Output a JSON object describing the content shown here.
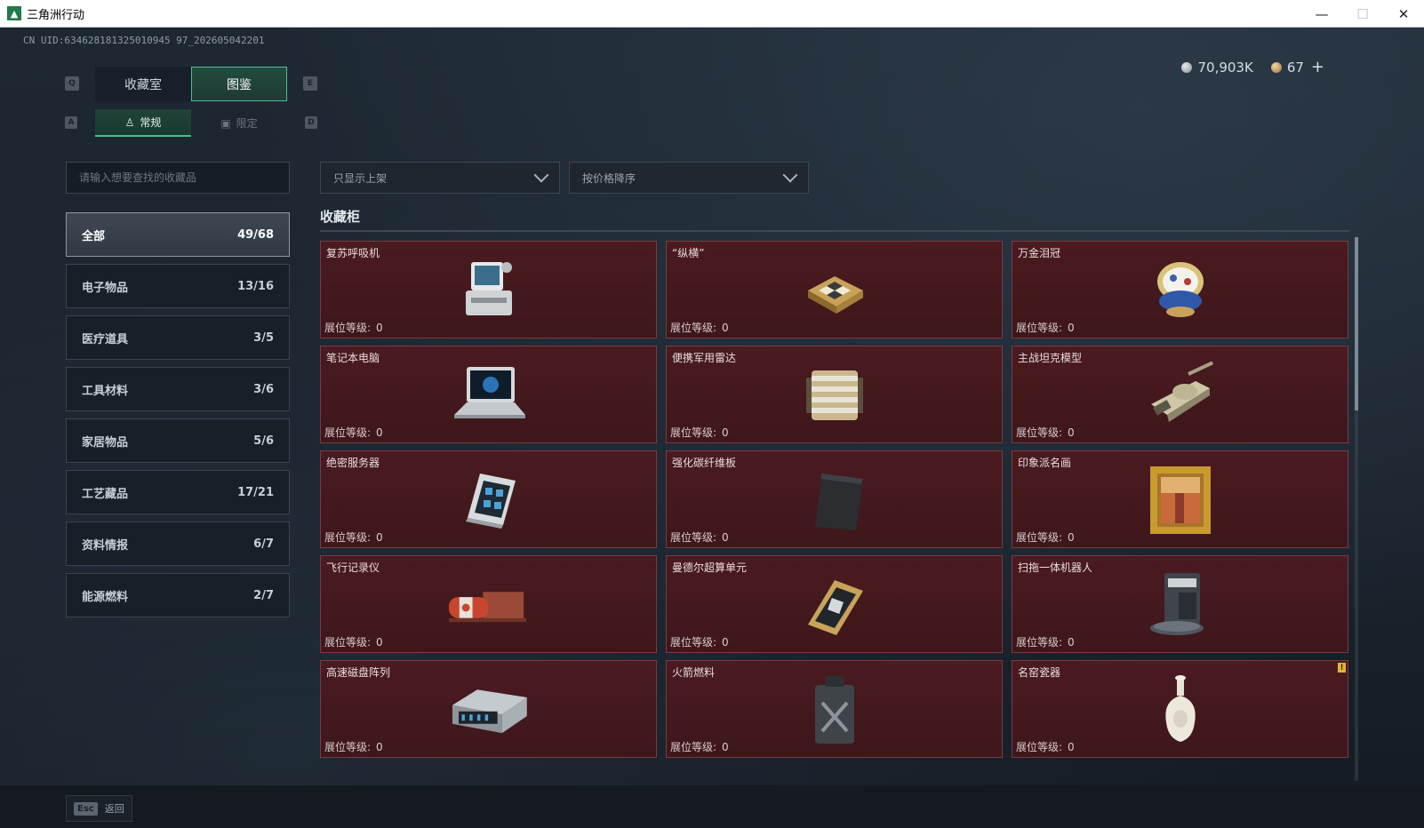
{
  "window": {
    "title": "三角洲行动",
    "app_icon": "triangle-logo-icon",
    "controls": [
      "minimize-icon",
      "maximize-icon",
      "close-icon"
    ]
  },
  "uid": "CN UID:634628181325010945 97_202605042201",
  "currency": {
    "silver": "70,903K",
    "gold": "67"
  },
  "main_tabs": {
    "key_left": "Q",
    "key_right": "E",
    "items": [
      {
        "label": "收藏室",
        "active": false
      },
      {
        "label": "图鉴",
        "active": true
      }
    ]
  },
  "sub_tabs": {
    "key_left": "A",
    "key_right": "D",
    "items": [
      {
        "label": "常规",
        "icon": "figure-icon",
        "active": true
      },
      {
        "label": "限定",
        "icon": "frame-icon",
        "active": false
      }
    ]
  },
  "search": {
    "placeholder": "请输入想要查找的收藏品",
    "value": ""
  },
  "filters": {
    "shelf": "只显示上架",
    "sort": "按价格降序"
  },
  "categories": [
    {
      "label": "全部",
      "count": "49/68",
      "active": true
    },
    {
      "label": "电子物品",
      "count": "13/16"
    },
    {
      "label": "医疗道具",
      "count": "3/5"
    },
    {
      "label": "工具材料",
      "count": "3/6"
    },
    {
      "label": "家居物品",
      "count": "5/6"
    },
    {
      "label": "工艺藏品",
      "count": "17/21"
    },
    {
      "label": "资料情报",
      "count": "6/7"
    },
    {
      "label": "能源燃料",
      "count": "2/7"
    }
  ],
  "cabinet": {
    "title": "收藏柜",
    "level_label": "展位等级:",
    "items": [
      {
        "name": "复苏呼吸机",
        "level": "0",
        "icon": "ventilator-icon"
      },
      {
        "name": "“纵横”",
        "level": "0",
        "icon": "chessboard-icon"
      },
      {
        "name": "万金泪冠",
        "level": "0",
        "icon": "jeweled-egg-icon"
      },
      {
        "name": "笔记本电脑",
        "level": "0",
        "icon": "laptop-icon"
      },
      {
        "name": "便携军用雷达",
        "level": "0",
        "icon": "radar-icon"
      },
      {
        "name": "主战坦克模型",
        "level": "0",
        "icon": "tank-icon"
      },
      {
        "name": "绝密服务器",
        "level": "0",
        "icon": "server-icon"
      },
      {
        "name": "强化碳纤维板",
        "level": "0",
        "icon": "carbon-plate-icon"
      },
      {
        "name": "印象派名画",
        "level": "0",
        "icon": "painting-icon"
      },
      {
        "name": "飞行记录仪",
        "level": "0",
        "icon": "flight-recorder-icon"
      },
      {
        "name": "曼德尔超算单元",
        "level": "0",
        "icon": "compute-unit-icon"
      },
      {
        "name": "扫拖一体机器人",
        "level": "0",
        "icon": "robot-vacuum-icon"
      },
      {
        "name": "高速磁盘阵列",
        "level": "0",
        "icon": "disk-array-icon"
      },
      {
        "name": "火箭燃料",
        "level": "0",
        "icon": "fuel-can-icon"
      },
      {
        "name": "名窑瓷器",
        "level": "0",
        "icon": "porcelain-vase-icon",
        "flag": "!"
      }
    ]
  },
  "bottom": {
    "esc_key": "Esc",
    "esc_label": "返回"
  }
}
